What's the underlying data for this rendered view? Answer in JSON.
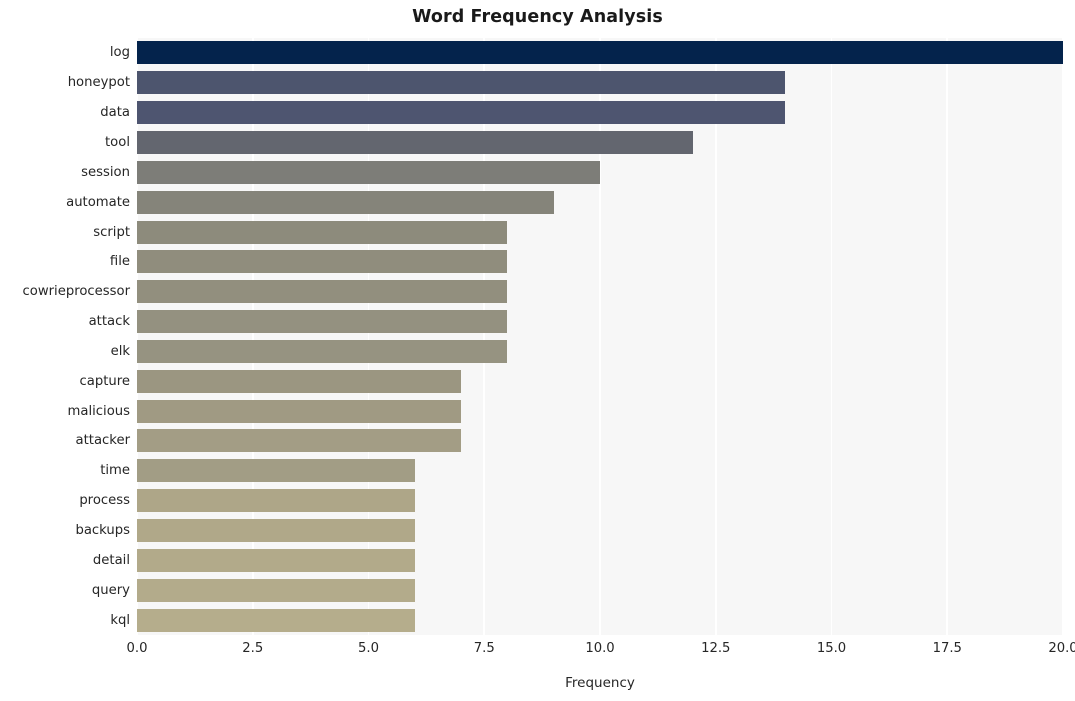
{
  "chart_data": {
    "type": "bar",
    "orientation": "horizontal",
    "title": "Word Frequency Analysis",
    "xlabel": "Frequency",
    "ylabel": "",
    "xlim": [
      0,
      20
    ],
    "xticks": [
      "0.0",
      "2.5",
      "5.0",
      "7.5",
      "10.0",
      "12.5",
      "15.0",
      "17.5",
      "20.0"
    ],
    "xtick_values": [
      0,
      2.5,
      5,
      7.5,
      10,
      12.5,
      15,
      17.5,
      20
    ],
    "grid": "vertical-white",
    "legend": "none",
    "background": "#f7f7f7",
    "categories": [
      "log",
      "honeypot",
      "data",
      "tool",
      "session",
      "automate",
      "script",
      "file",
      "cowrieprocessor",
      "attack",
      "elk",
      "capture",
      "malicious",
      "attacker",
      "time",
      "process",
      "backups",
      "detail",
      "query",
      "kql"
    ],
    "values": [
      20,
      14,
      14,
      12,
      10,
      9,
      8,
      8,
      8,
      8,
      8,
      7,
      7,
      7,
      6,
      6,
      6,
      6,
      6,
      6
    ],
    "bar_colors": [
      "#04234c",
      "#4d556e",
      "#4e5570",
      "#63666f",
      "#7d7d78",
      "#85847a",
      "#8d8b7c",
      "#908d7d",
      "#928f7e",
      "#949180",
      "#969381",
      "#9b9681",
      "#a09a83",
      "#a39d85",
      "#ac a487",
      "#aea688",
      "#b0a889",
      "#b2aa8a",
      "#b3ab8b",
      "#b5ad8c"
    ],
    "palette_name": "navy-to-khaki-gradient"
  }
}
